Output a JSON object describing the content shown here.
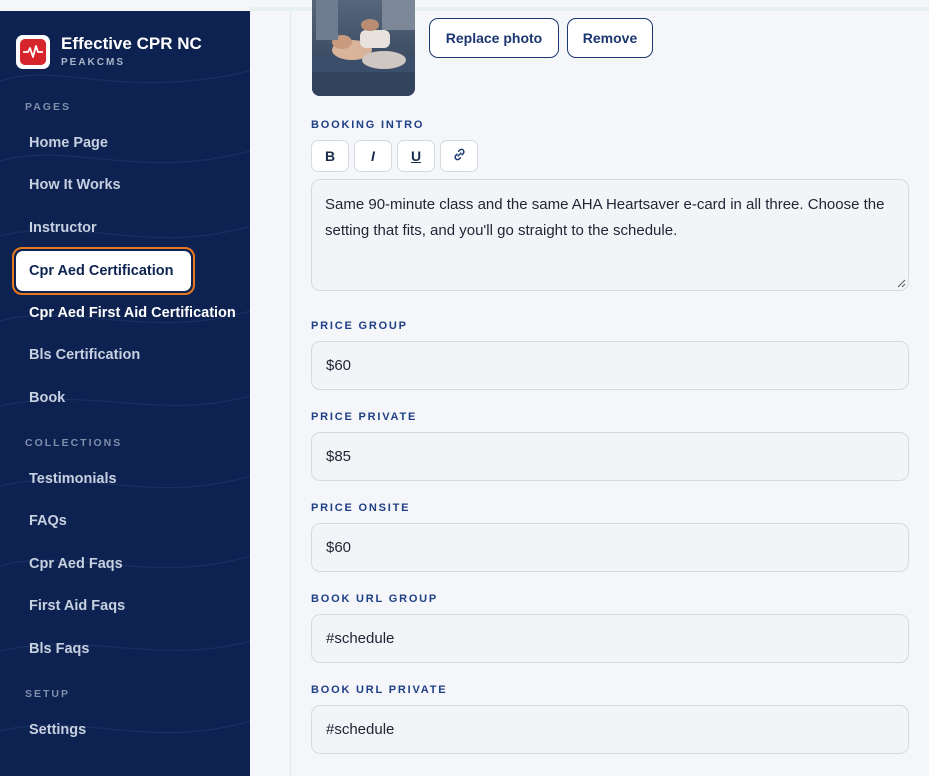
{
  "brand": {
    "title": "Effective CPR NC",
    "subtitle": "PEAKCMS",
    "logo_color": "#d7262b"
  },
  "sidebar": {
    "sections": {
      "pages": "PAGES",
      "collections": "COLLECTIONS",
      "setup": "SETUP"
    },
    "pages": [
      {
        "label": "Home Page"
      },
      {
        "label": "How It Works"
      },
      {
        "label": "Instructor"
      },
      {
        "label": "Cpr Aed Certification",
        "active": true
      },
      {
        "label": "Cpr Aed First Aid Certification"
      },
      {
        "label": "Bls Certification"
      },
      {
        "label": "Book"
      }
    ],
    "collections": [
      {
        "label": "Testimonials"
      },
      {
        "label": "FAQs"
      },
      {
        "label": "Cpr Aed Faqs"
      },
      {
        "label": "First Aid Faqs"
      },
      {
        "label": "Bls Faqs"
      }
    ],
    "setup": [
      {
        "label": "Settings"
      }
    ]
  },
  "photo": {
    "replace_label": "Replace photo",
    "remove_label": "Remove"
  },
  "booking_intro": {
    "label": "BOOKING INTRO",
    "toolbar": {
      "bold": "B",
      "italic": "I",
      "underline": "U",
      "link_icon": "link-icon"
    },
    "value": "Same 90-minute class and the same AHA Heartsaver e-card in all three. Choose the setting that fits, and you'll go straight to the schedule."
  },
  "fields": {
    "price_group": {
      "label": "PRICE GROUP",
      "value": "$60"
    },
    "price_private": {
      "label": "PRICE PRIVATE",
      "value": "$85"
    },
    "price_onsite": {
      "label": "PRICE ONSITE",
      "value": "$60"
    },
    "book_url_group": {
      "label": "BOOK URL GROUP",
      "value": "#schedule"
    },
    "book_url_private": {
      "label": "BOOK URL PRIVATE",
      "value": "#schedule"
    }
  },
  "colors": {
    "sidebar_bg": "#0d2250",
    "accent_active": "#e8771e",
    "label_blue": "#1f3f86"
  }
}
